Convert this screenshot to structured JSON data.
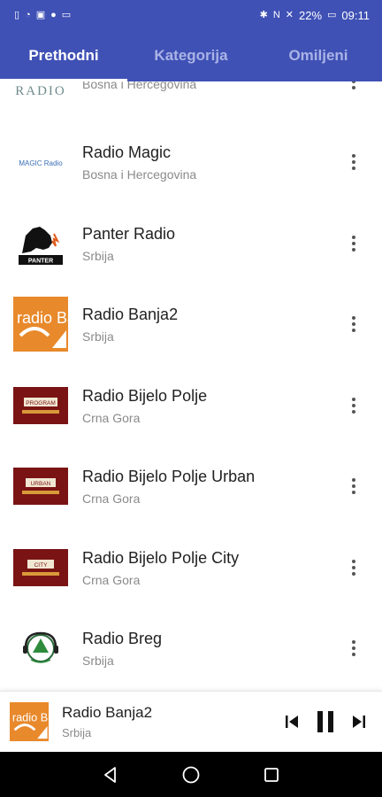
{
  "status_bar": {
    "battery": "22%",
    "time": "09:11"
  },
  "tabs": [
    {
      "label": "Prethodni",
      "active": true
    },
    {
      "label": "Kategorija",
      "active": false
    },
    {
      "label": "Omiljeni",
      "active": false
    }
  ],
  "stations": [
    {
      "name": "",
      "country": "Bosna i Hercegovina",
      "logo_text": "RADIO"
    },
    {
      "name": "Radio Magic",
      "country": "Bosna i Hercegovina",
      "logo_text": "MAGIC Radio"
    },
    {
      "name": "Panter Radio",
      "country": "Srbija",
      "logo_text": "PANTER"
    },
    {
      "name": "Radio Banja2",
      "country": "Srbija",
      "logo_text": "radio Banja"
    },
    {
      "name": "Radio Bijelo Polje",
      "country": "Crna Gora",
      "logo_text": "PROGRAM"
    },
    {
      "name": "Radio Bijelo Polje Urban",
      "country": "Crna Gora",
      "logo_text": "URBAN"
    },
    {
      "name": "Radio Bijelo Polje City",
      "country": "Crna Gora",
      "logo_text": "CITY"
    },
    {
      "name": "Radio Breg",
      "country": "Srbija",
      "logo_text": ""
    }
  ],
  "player": {
    "name": "Radio Banja2",
    "country": "Srbija",
    "logo_text": "radio Banja"
  },
  "colors": {
    "primary": "#3f51b5",
    "banja_orange": "#e8892b",
    "bijelo_red": "#7a1414"
  }
}
